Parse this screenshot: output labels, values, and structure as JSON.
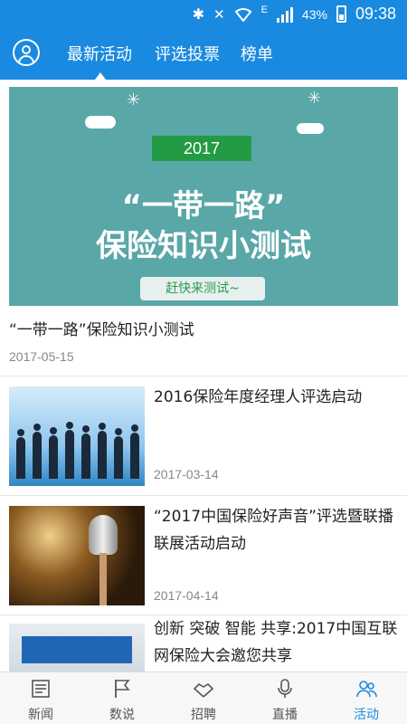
{
  "status_bar": {
    "network": "E",
    "battery_percent": "43%",
    "time": "09:38",
    "icons": [
      "bluetooth-icon",
      "mute-icon",
      "wifi-icon",
      "signal-icon",
      "battery-icon"
    ]
  },
  "top_nav": {
    "tabs": [
      {
        "label": "最新活动",
        "active": true
      },
      {
        "label": "评选投票",
        "active": false
      },
      {
        "label": "榜单",
        "active": false
      }
    ]
  },
  "featured": {
    "banner": {
      "year": "2017",
      "line1": "“一带一路”",
      "line2": "保险知识小测试",
      "cta": "赶快来测试~"
    },
    "title": "“一带一路”保险知识小测试",
    "date": "2017-05-15"
  },
  "news": [
    {
      "title": "2016保险年度经理人评选启动",
      "date": "2017-03-14",
      "thumb": "team-silhouettes"
    },
    {
      "title": "“2017中国保险好声音”评选暨联播联展活动启动",
      "date": "2017-04-14",
      "thumb": "microphone"
    },
    {
      "title": "创新 突破 智能 共享:2017中国互联网保险大会邀您共享",
      "date": "",
      "thumb": "conference"
    }
  ],
  "bottom_nav": {
    "items": [
      {
        "label": "新闻",
        "icon": "newspaper-icon",
        "active": false
      },
      {
        "label": "数说",
        "icon": "flag-icon",
        "active": false
      },
      {
        "label": "招聘",
        "icon": "handshake-icon",
        "active": false
      },
      {
        "label": "直播",
        "icon": "microphone-icon",
        "active": false
      },
      {
        "label": "活动",
        "icon": "people-icon",
        "active": true
      }
    ]
  },
  "colors": {
    "primary": "#1a8ae0",
    "banner_bg": "#5aa7a8",
    "ribbon_green": "#239b45"
  }
}
